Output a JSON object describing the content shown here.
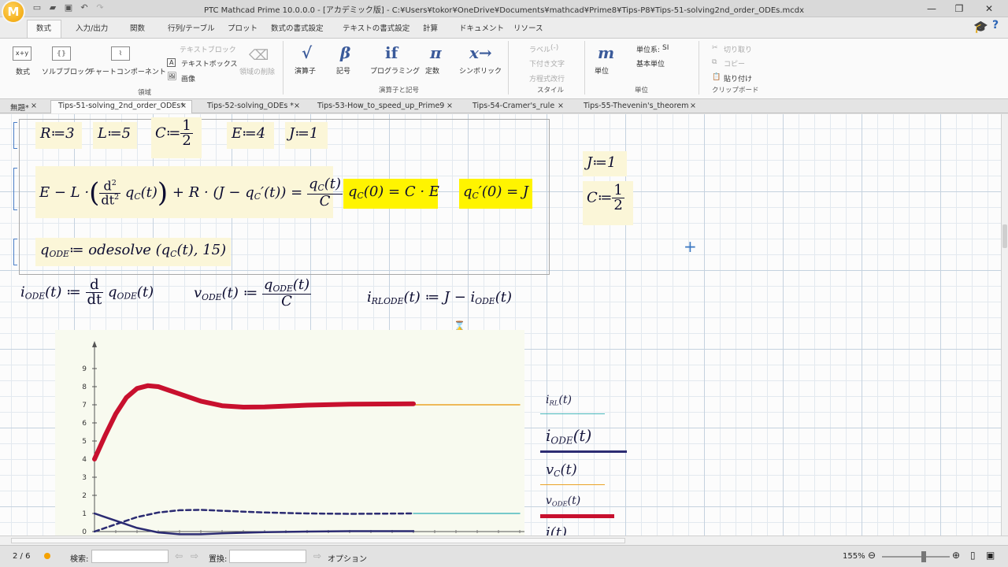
{
  "window": {
    "title": "PTC Mathcad Prime 10.0.0.0 - [アカデミック版] - C:¥Users¥tokor¥OneDrive¥Documents¥mathcad¥Prime8¥Tips-P8¥Tips-51-solving2nd_order_ODEs.mcdx",
    "logo": "M"
  },
  "ribbon_tabs": [
    "数式",
    "入力/出力",
    "関数",
    "行列/テーブル",
    "プロット",
    "数式の書式設定",
    "テキストの書式設定",
    "計算",
    "ドキュメント",
    "リソース"
  ],
  "ribbon": {
    "region": {
      "math": "数式",
      "solve_block": "ソルブブロック",
      "chart": "チャートコンポーネント",
      "text_block": "テキストブロック",
      "text_box": "テキストボックス",
      "image": "画像",
      "delete_region": "領域の削除",
      "group": "領域"
    },
    "operators": {
      "operator": "演算子",
      "symbol": "記号",
      "programming": "プログラミング",
      "constant": "定数",
      "symbolic": "シンボリック",
      "group": "演算子と記号",
      "op_glyph": "√",
      "sym_glyph": "β",
      "prog_glyph": "if",
      "const_glyph": "π",
      "symb_glyph": "x→"
    },
    "style": {
      "label": "ラベル",
      "label_value": "(-)",
      "subscript": "下付き文字",
      "line_break": "方程式改行",
      "group": "スタイル"
    },
    "units": {
      "unit": "単位",
      "unit_system": "単位系:",
      "unit_system_value": "SI",
      "base_unit": "基本単位",
      "group": "単位",
      "glyph": "m"
    },
    "clipboard": {
      "cut": "切り取り",
      "copy": "コピー",
      "paste": "貼り付け",
      "group": "クリップボード"
    }
  },
  "doc_tabs": [
    {
      "label": "無題*",
      "active": false
    },
    {
      "label": "Tips-51-solving_2nd_order_ODEs*",
      "active": true
    },
    {
      "label": "Tips-52-solving_ODEs *",
      "active": false
    },
    {
      "label": "Tips-53-How_to_speed_up_Prime9",
      "active": false
    },
    {
      "label": "Tips-54-Cramer's_rule",
      "active": false
    },
    {
      "label": "Tips-55-Thevenin's_theorem",
      "active": false
    }
  ],
  "tab_close": "×",
  "math": {
    "R": "R≔3",
    "L": "L≔5",
    "C_lhs": "C≔",
    "C_num": "1",
    "C_den": "2",
    "E": "E≔4",
    "J": "J≔1",
    "ode_lhs1": "E − L ·",
    "ode_d2": "d",
    "ode_d2sup": "2",
    "ode_dt2": "dt",
    "ode_dt2sup": "2",
    "ode_qc": "q",
    "ode_qc_sub": "C",
    "ode_t": "(t)",
    "ode_mid": "+ R · (J − q",
    "ode_qcp_sub": "C",
    "ode_mid2": "′(t)) =",
    "ode_rhs_num": "q",
    "ode_rhs_num_sub": "C",
    "ode_rhs_num2": "(t)",
    "ode_rhs_den": "C",
    "ic1": "q",
    "ic1_sub": "C",
    "ic1_rest": "(0) = C · E",
    "ic2": "q",
    "ic2_sub": "C",
    "ic2_rest": "′(0) = J",
    "qode": "q",
    "qode_sub": "ODE",
    "qode_rest": "≔ odesolve (q",
    "qode_sub2": "C",
    "qode_rest2": "(t), 15)",
    "iode": "i",
    "iode_sub": "ODE",
    "iode_rest": "(t) ≔",
    "iode_d": "d",
    "iode_dt": "dt",
    "iode_q": "q",
    "iode_q_sub": "ODE",
    "iode_q_rest": "(t)",
    "vode": "v",
    "vode_sub": "ODE",
    "vode_rest": "(t) ≔",
    "vode_num": "q",
    "vode_num_sub": "ODE",
    "vode_num_rest": "(t)",
    "vode_den": "C",
    "irl": "i",
    "irl_sub": "RLODE",
    "irl_rest": "(t) ≔ J − i",
    "irl_sub2": "ODE",
    "irl_rest2": "(t)",
    "side_J": "J≔1",
    "side_C": "C≔",
    "side_C_num": "1",
    "side_C_den": "2",
    "cursor": "+",
    "hourglass": "⌛"
  },
  "legend": [
    {
      "name": "i",
      "sub": "RL",
      "arg": "(t)",
      "color": "#4ab9bd"
    },
    {
      "name": "i",
      "sub": "ODE",
      "arg": "(t)",
      "color": "#2b2b72"
    },
    {
      "name": "v",
      "sub": "C",
      "arg": "(t)",
      "color": "#eaa326"
    },
    {
      "name": "v",
      "sub": "ODE",
      "arg": "(t)",
      "color": "#c8102e"
    },
    {
      "name": "i",
      "sub": "",
      "arg": "(t)",
      "color": "#2b2b72"
    }
  ],
  "chart_data": {
    "type": "line",
    "title": "",
    "xlabel": "",
    "ylabel": "",
    "ylim": [
      0,
      9
    ],
    "xlim": [
      0,
      20
    ],
    "y_ticks": [
      "0",
      "1",
      "2",
      "3",
      "4",
      "5",
      "6",
      "7",
      "8",
      "9"
    ],
    "grid": false,
    "legend_placement": "right",
    "series": [
      {
        "name": "iRL(t)",
        "color": "#4ab9bd",
        "style": "solid",
        "x": [
          15,
          20
        ],
        "y": [
          1.0,
          1.0
        ]
      },
      {
        "name": "iODE(t)",
        "color": "#2b2b72",
        "style": "solid",
        "x": [
          0,
          1,
          2,
          3,
          4,
          5,
          6,
          8,
          10,
          12,
          15
        ],
        "y": [
          1.0,
          0.6,
          0.2,
          -0.05,
          -0.15,
          -0.15,
          -0.1,
          -0.03,
          0.0,
          0.02,
          0.02
        ]
      },
      {
        "name": "vC(t)",
        "color": "#eaa326",
        "style": "solid",
        "x": [
          15,
          20
        ],
        "y": [
          7.0,
          7.0
        ]
      },
      {
        "name": "vODE(t)",
        "color": "#c8102e",
        "style": "solid",
        "x": [
          0,
          0.5,
          1,
          1.5,
          2,
          2.5,
          3,
          3.5,
          4,
          5,
          6,
          7,
          8,
          9,
          10,
          12,
          15
        ],
        "y": [
          4.0,
          5.3,
          6.5,
          7.4,
          7.9,
          8.05,
          8.0,
          7.8,
          7.6,
          7.2,
          6.95,
          6.87,
          6.88,
          6.93,
          6.98,
          7.03,
          7.05
        ]
      },
      {
        "name": "i(t)",
        "color": "#2b2b72",
        "style": "dashed",
        "x": [
          0,
          1,
          2,
          3,
          4,
          5,
          6,
          7,
          8,
          10,
          12,
          15
        ],
        "y": [
          0.0,
          0.4,
          0.8,
          1.05,
          1.18,
          1.2,
          1.15,
          1.1,
          1.05,
          1.0,
          0.98,
          1.0
        ]
      }
    ]
  },
  "status": {
    "page": "2 / 6",
    "search_label": "検索:",
    "replace_label": "置換:",
    "options": "オプション",
    "zoom": "155%"
  }
}
